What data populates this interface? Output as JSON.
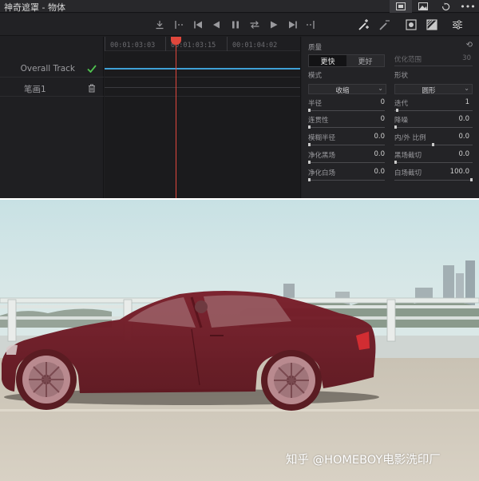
{
  "window": {
    "title": "神奇遮罩 - 物体",
    "header_icons": [
      "image-view-icon",
      "photo-icon",
      "reset-icon",
      "more-icon"
    ],
    "more_label": "•••"
  },
  "transport": {
    "buttons": [
      "track-forward-icon",
      "mark-in-icon",
      "jump-start-icon",
      "step-back-icon",
      "pause-icon",
      "loop-icon",
      "play-icon",
      "jump-end-icon",
      "mark-out-icon"
    ],
    "tools": [
      "magic-wand-add-icon",
      "magic-wand-subtract-icon",
      "mask-overlay-icon",
      "matte-toggle-icon",
      "settings-sliders-icon"
    ]
  },
  "tracks": [
    {
      "label": "Overall Track",
      "icon": "checkmark-icon"
    },
    {
      "label": "笔画1",
      "icon": "trash-icon"
    }
  ],
  "timeline": {
    "timecodes": [
      "00:01:03:03",
      "00:01:03:15",
      "00:01:04:02"
    ],
    "playhead_timecode": "00:01:03:15"
  },
  "inspector": {
    "quality_label": "质量",
    "quality_options": [
      "更快",
      "更好"
    ],
    "quality_selected": "更快",
    "refine_range_label": "优化范围",
    "refine_range_value": "30",
    "mode_label": "模式",
    "mode_value": "收缩",
    "shape_label": "形状",
    "shape_value": "圆形",
    "params_left": [
      {
        "label": "半径",
        "value": "0"
      },
      {
        "label": "连贯性",
        "value": "0"
      },
      {
        "label": "模糊半径",
        "value": "0.0"
      },
      {
        "label": "净化黑场",
        "value": "0.0"
      },
      {
        "label": "净化白场",
        "value": "0.0"
      }
    ],
    "params_right": [
      {
        "label": "迭代",
        "value": "1"
      },
      {
        "label": "降噪",
        "value": "0.0"
      },
      {
        "label": "内/外 比例",
        "value": "0.0"
      },
      {
        "label": "黑场截切",
        "value": "0.0"
      },
      {
        "label": "白场截切",
        "value": "100.0"
      }
    ]
  },
  "video": {
    "watermark": "知乎 @HOMEBOY电影洗印厂"
  },
  "colors": {
    "playhead": "#e0473c",
    "track_line": "#3fa0d6",
    "check": "#4fc24f",
    "mask_overlay": "#8a1e2a"
  }
}
